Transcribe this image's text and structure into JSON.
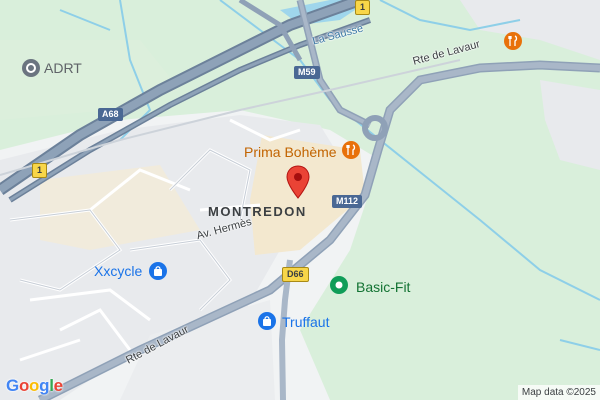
{
  "colors": {
    "green_area": "#d4ecd5",
    "urban_area": "#e8eaed",
    "sand_area": "#f1ebdc",
    "highway": "#7e92a8",
    "primary_road": "#9aa9bb",
    "water": "#7ec8e3",
    "poi_blue": "#1a73e8",
    "poi_green": "#0f9d58",
    "poi_orange": "#e8710a",
    "marker_red": "#ea4335"
  },
  "labels": {
    "adrt": "ADRT",
    "la_sausse": "La Sausse",
    "prima_boheme": "Prima Bohème",
    "montredon": "MONTREDON",
    "av_hermes": "Av. Hermès",
    "xxcycle": "Xxcycle",
    "basic_fit": "Basic-Fit",
    "truffaut": "Truffaut",
    "rte_de_lavaur_top": "Rte de Lavaur",
    "rte_de_lavaur_bottom": "Rte de Lavaur"
  },
  "shields": {
    "a68": "A68",
    "m59": "M59",
    "m112": "M112",
    "d66": "D66",
    "one_top": "1",
    "one_left": "1"
  },
  "icons": {
    "adrt": "location-icon",
    "prima_boheme": "restaurant-icon",
    "restaurant_top_right": "restaurant-icon",
    "xxcycle": "shopping-bag-icon",
    "truffaut": "shopping-bag-icon",
    "basic_fit": "fitness-icon",
    "selected_location": "map-pin-icon"
  },
  "branding": {
    "logo": "Google",
    "attribution": "Map data ©2025"
  }
}
